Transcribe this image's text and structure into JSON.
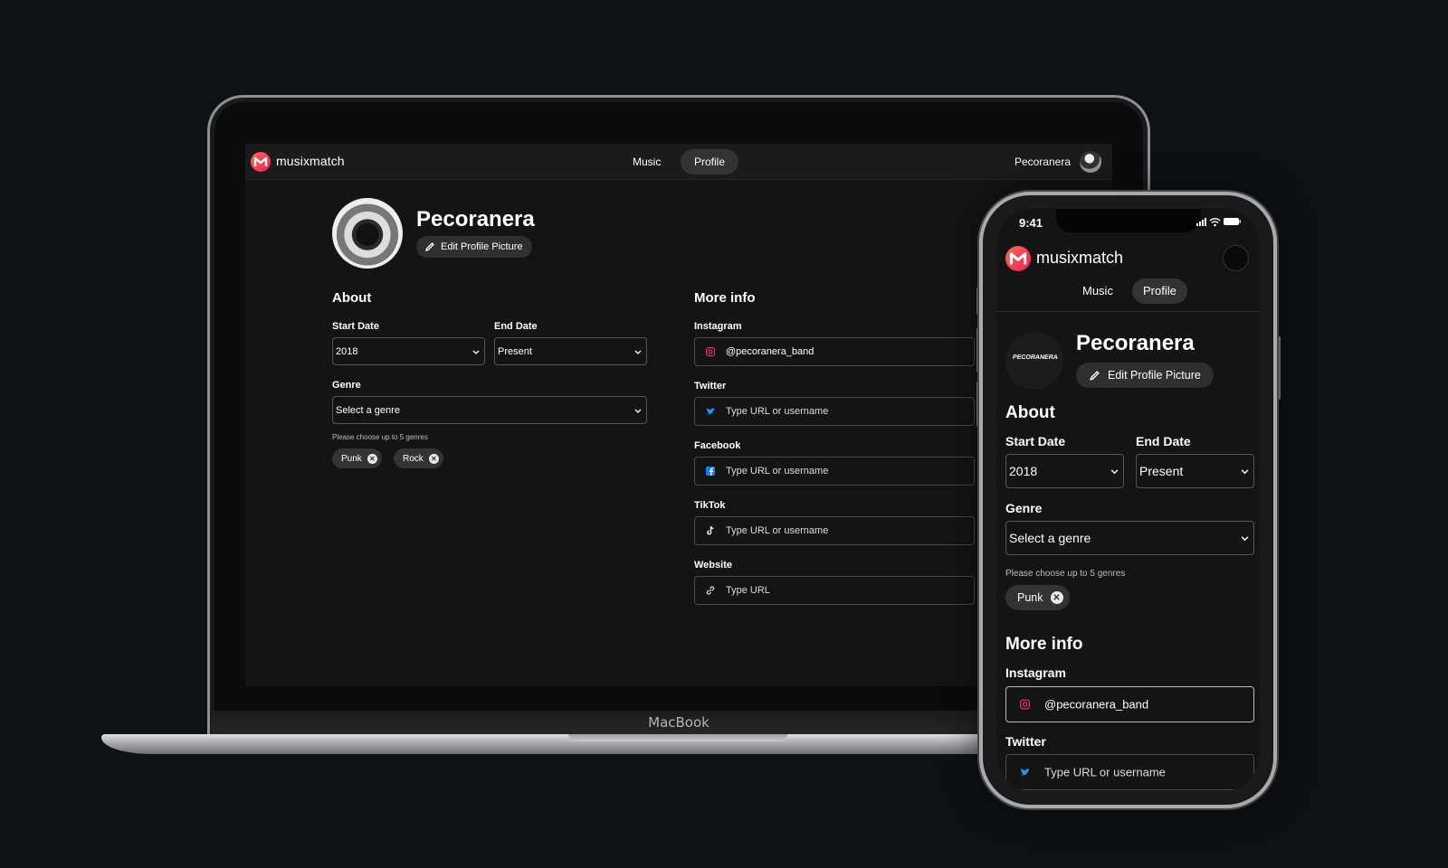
{
  "desktop": {
    "device_label": "MacBook",
    "nav": {
      "logo": "musixmatch",
      "tabs": [
        "Music",
        "Profile"
      ],
      "active_tab": "Profile",
      "user_name": "Pecoranera"
    },
    "profile": {
      "name": "Pecoranera",
      "edit_picture_label": "Edit Profile Picture"
    },
    "about": {
      "title": "About",
      "start_date_label": "Start Date",
      "start_date_value": "2018",
      "end_date_label": "End Date",
      "end_date_value": "Present",
      "genre_label": "Genre",
      "genre_placeholder": "Select a genre",
      "genre_hint": "Please choose up to 5 genres",
      "genres": [
        "Punk",
        "Rock"
      ]
    },
    "more_info": {
      "title": "More info",
      "fields": [
        {
          "label": "Instagram",
          "value": "@pecoranera_band",
          "icon": "instagram-icon"
        },
        {
          "label": "Twitter",
          "value": "Type URL or username",
          "icon": "twitter-icon"
        },
        {
          "label": "Facebook",
          "value": "Type URL or username",
          "icon": "facebook-icon"
        },
        {
          "label": "TikTok",
          "value": "Type URL or username",
          "icon": "tiktok-icon"
        },
        {
          "label": "Website",
          "value": "Type URL",
          "icon": "link-icon"
        }
      ]
    }
  },
  "mobile": {
    "status_time": "9:41",
    "nav": {
      "logo": "musixmatch",
      "tabs": [
        "Music",
        "Profile"
      ],
      "active_tab": "Profile"
    },
    "profile": {
      "name": "Pecoranera",
      "avatar_text": "PECORANERA",
      "edit_picture_label": "Edit Profile Picture"
    },
    "about": {
      "title": "About",
      "start_date_label": "Start Date",
      "start_date_value": "2018",
      "end_date_label": "End Date",
      "end_date_value": "Present",
      "genre_label": "Genre",
      "genre_placeholder": "Select a genre",
      "genre_hint": "Please choose up to 5 genres",
      "genres": [
        "Punk"
      ]
    },
    "more_info": {
      "title": "More info",
      "fields": [
        {
          "label": "Instagram",
          "value": "@pecoranera_band",
          "icon": "instagram-icon"
        },
        {
          "label": "Twitter",
          "value": "Type URL or username",
          "icon": "twitter-icon"
        }
      ]
    }
  },
  "colors": {
    "background": "#0e1216",
    "screen": "#141414",
    "brand": "#e91e5b",
    "chip": "#333333",
    "twitter": "#1d9bf0",
    "facebook": "#1877f2",
    "instagram": "#e1306c"
  }
}
